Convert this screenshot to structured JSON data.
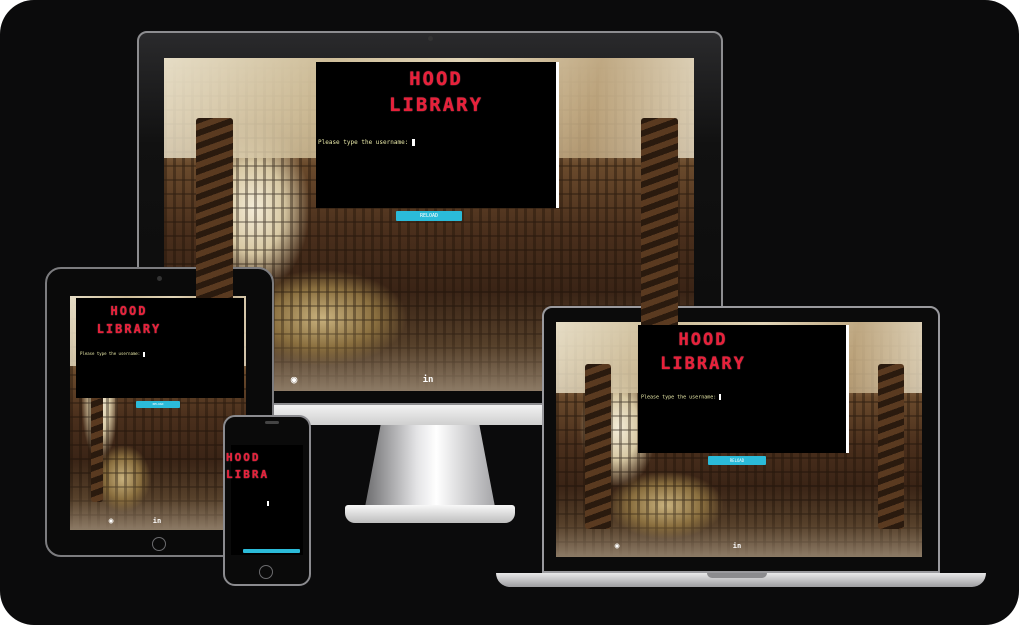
{
  "app": {
    "title_line1": "HOOD",
    "title_line2": "LIBRARY",
    "prompt": "Please type the username:",
    "button_label": "RELOAD",
    "footer_icons": [
      "github-icon",
      "linkedin-icon"
    ],
    "colors": {
      "background": "#0b0b0c",
      "terminal": "#000000",
      "logo": "#e8203a",
      "prompt_text": "#e9e9a8",
      "button": "#2bbbd9"
    }
  }
}
